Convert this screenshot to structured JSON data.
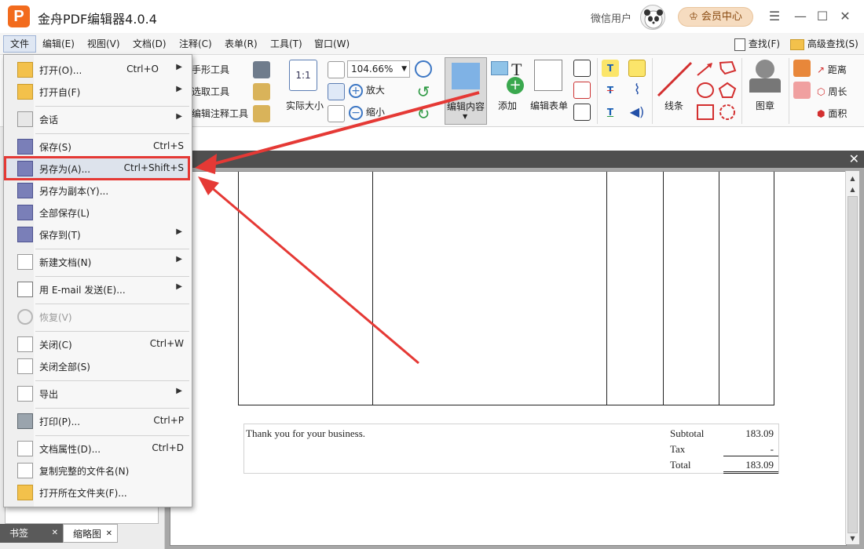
{
  "titlebar": {
    "title": "金舟PDF编辑器4.0.4",
    "logo_letter": "P",
    "user": "微信用户",
    "vip": "会员中心"
  },
  "menubar": {
    "items": [
      "文件",
      "编辑(E)",
      "视图(V)",
      "文档(D)",
      "注释(C)",
      "表单(R)",
      "工具(T)",
      "窗口(W)"
    ],
    "find": "查找(F)",
    "advanced_find": "高级查找(S)"
  },
  "toolbar": {
    "hand_tool": "手形工具",
    "select_tool": "选取工具",
    "annot_select_tool": "编辑注释工具",
    "actual_size": "实际大小",
    "zoom_value": "104.66%",
    "zoom_in": "放大",
    "zoom_out": "缩小",
    "edit_content": "编辑内容",
    "add": "添加",
    "edit_form": "编辑表单",
    "lines": "线条",
    "stamp": "图章",
    "distance": "距离",
    "perimeter": "周长",
    "area": "面积",
    "actual_size_icon_text": "1:1",
    "text_icon": "T"
  },
  "file_menu": {
    "items": [
      {
        "label": "打开(O)...",
        "shortcut": "Ctrl+O",
        "submenu": true
      },
      {
        "label": "打开自(F)",
        "shortcut": "",
        "submenu": true
      },
      {
        "label": "会话",
        "shortcut": "",
        "submenu": true
      },
      {
        "label": "保存(S)",
        "shortcut": "Ctrl+S",
        "submenu": false
      },
      {
        "label": "另存为(A)...",
        "shortcut": "Ctrl+Shift+S",
        "submenu": false
      },
      {
        "label": "另存为副本(Y)...",
        "shortcut": "",
        "submenu": false
      },
      {
        "label": "全部保存(L)",
        "shortcut": "",
        "submenu": false
      },
      {
        "label": "保存到(T)",
        "shortcut": "",
        "submenu": true
      },
      {
        "label": "新建文档(N)",
        "shortcut": "",
        "submenu": true
      },
      {
        "label": "用 E-mail 发送(E)...",
        "shortcut": "",
        "submenu": true
      },
      {
        "label": "恢复(V)",
        "shortcut": "",
        "submenu": false
      },
      {
        "label": "关闭(C)",
        "shortcut": "Ctrl+W",
        "submenu": false
      },
      {
        "label": "关闭全部(S)",
        "shortcut": "",
        "submenu": false
      },
      {
        "label": "导出",
        "shortcut": "",
        "submenu": true
      },
      {
        "label": "打印(P)...",
        "shortcut": "Ctrl+P",
        "submenu": false
      },
      {
        "label": "文档属性(D)...",
        "shortcut": "Ctrl+D",
        "submenu": false
      },
      {
        "label": "复制完整的文件名(N)",
        "shortcut": "",
        "submenu": false
      },
      {
        "label": "打开所在文件夹(F)...",
        "shortcut": "",
        "submenu": false
      }
    ]
  },
  "left_tabs": [
    "书签",
    "缩略图"
  ],
  "invoice": {
    "thanks": "Thank you for your business.",
    "subtotal_label": "Subtotal",
    "subtotal_value": "183.09",
    "tax_label": "Tax",
    "tax_value": "-",
    "total_label": "Total",
    "total_value": "183.09"
  },
  "colors": {
    "brand_orange": "#f26b1d",
    "highlight_red": "#e53935",
    "vip_bg": "#f6dcc0"
  }
}
